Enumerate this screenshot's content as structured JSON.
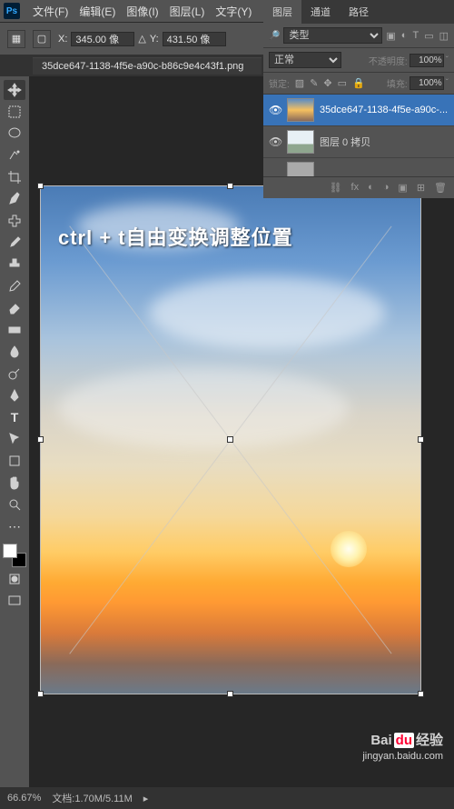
{
  "menubar": {
    "logo": "Ps",
    "items": [
      "文件(F)",
      "编辑(E)",
      "图像(I)",
      "图层(L)",
      "文字(Y)"
    ]
  },
  "options": {
    "x_label": "X:",
    "x_value": "345.00 像",
    "y_label": "Y:",
    "y_value": "431.50 像"
  },
  "doc_tab": "35dce647-1138-4f5e-a90c-b86c9e4c43f1.png",
  "caption": "ctrl + t自由变换调整位置",
  "layers_panel": {
    "tabs": [
      "图层",
      "通道",
      "路径"
    ],
    "filter_kind": "类型",
    "blend_mode": "正常",
    "opacity_label": "不透明度:",
    "opacity_value": "100%",
    "lock_label": "锁定:",
    "fill_label": "填充:",
    "fill_value": "100%",
    "layers": [
      {
        "visible": true,
        "name": "35dce647-1138-4f5e-a90c-...",
        "selected": true,
        "thumb": "sky"
      },
      {
        "visible": true,
        "name": "图层 0 拷贝",
        "selected": false,
        "thumb": "person"
      },
      {
        "visible": false,
        "name": "",
        "selected": false,
        "thumb": "blank"
      }
    ]
  },
  "status": {
    "zoom": "66.67%",
    "doc_info": "文档:1.70M/5.11M"
  },
  "watermark": {
    "brand_pre": "Bai",
    "brand_mid": "du",
    "brand_post": "经验",
    "url": "jingyan.baidu.com"
  }
}
